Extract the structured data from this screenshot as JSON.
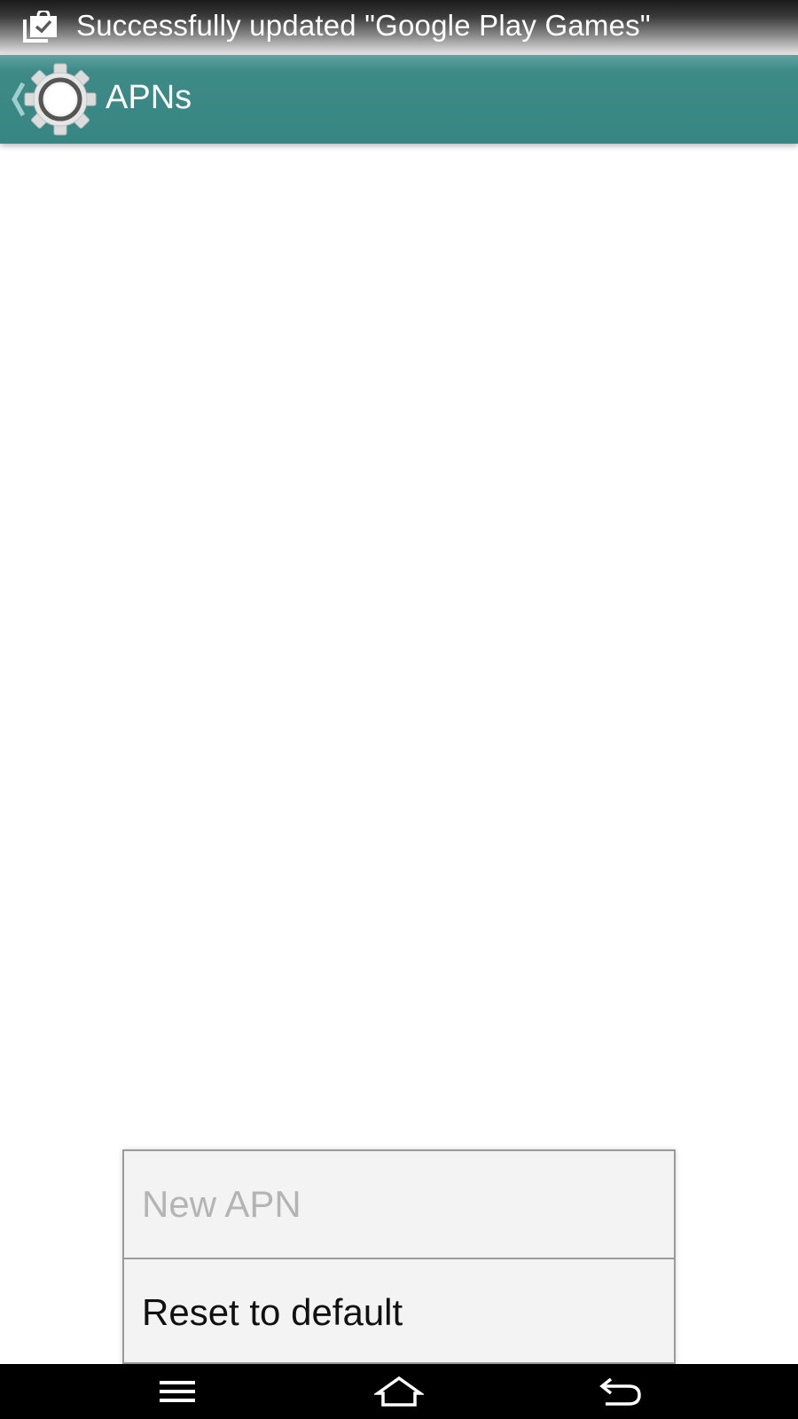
{
  "status_bar": {
    "ticker_text": "Successfully updated \"Google Play Games\"",
    "ticker_icon": "app-update-done-icon"
  },
  "action_bar": {
    "title": "APNs",
    "up_icon": "up-caret-icon",
    "app_icon": "settings-gear-icon",
    "color": "#3a8885"
  },
  "menu": {
    "items": [
      {
        "label": "New APN",
        "enabled": false
      },
      {
        "label": "Reset to default",
        "enabled": true
      }
    ]
  },
  "nav_bar": {
    "buttons": [
      "menu-icon",
      "home-icon",
      "back-icon"
    ]
  }
}
